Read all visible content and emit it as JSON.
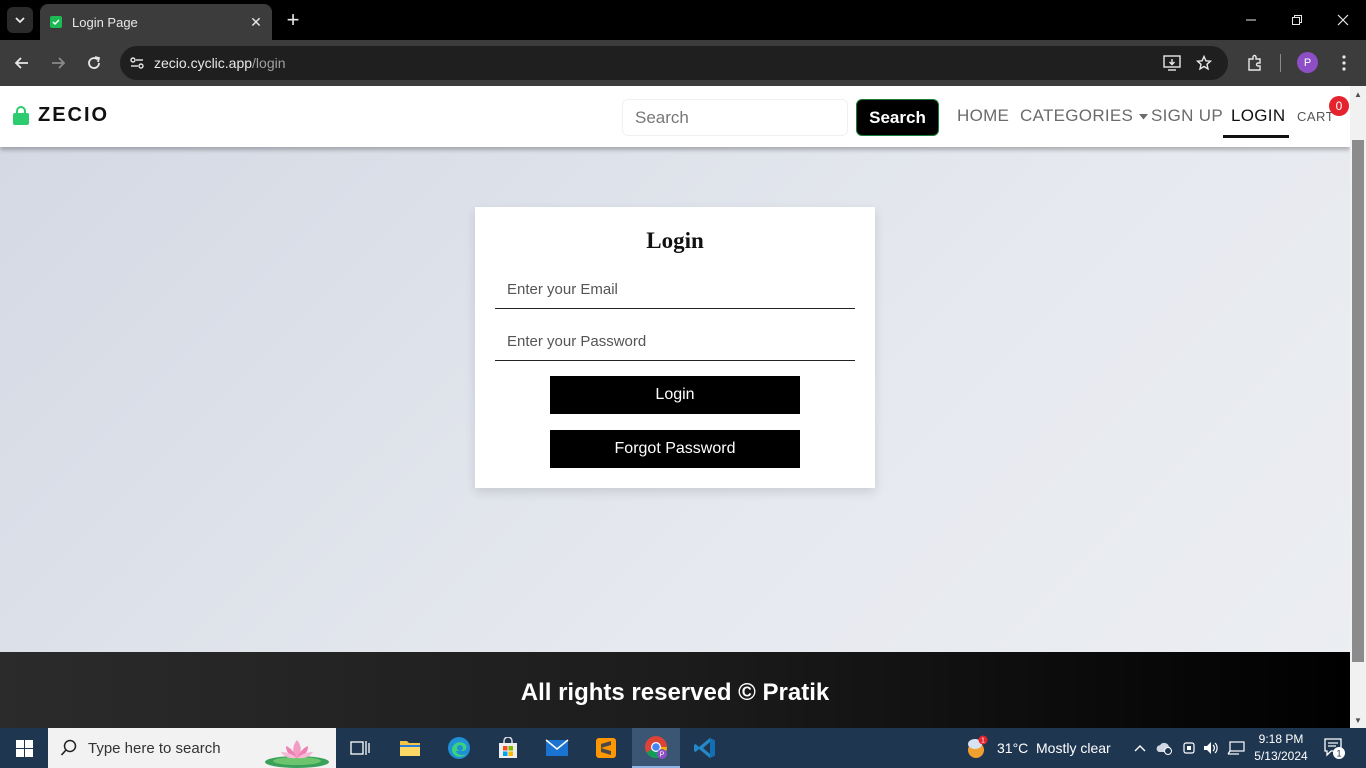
{
  "browser": {
    "tab_title": "Login Page",
    "url_domain": "zecio.cyclic.app",
    "url_path": "/login",
    "profile_initial": "P"
  },
  "site": {
    "brand": "ZECIO",
    "search_placeholder": "Search",
    "search_button": "Search",
    "nav": {
      "home": "HOME",
      "categories": "CATEGORIES",
      "signup": "SIGN UP",
      "login": "LOGIN",
      "cart": "CART",
      "cart_count": "0"
    }
  },
  "login_form": {
    "title": "Login",
    "email_placeholder": "Enter your Email",
    "password_placeholder": "Enter your Password",
    "login_button": "Login",
    "forgot_button": "Forgot Password"
  },
  "footer": {
    "text": "All rights reserved © Pratik"
  },
  "taskbar": {
    "search_placeholder": "Type here to search",
    "weather_temp": "31°C",
    "weather_desc": "Mostly clear",
    "weather_badge": "1",
    "time": "9:18 PM",
    "date": "5/13/2024",
    "notification_count": "1"
  },
  "colors": {
    "cart_badge": "#e5232e",
    "brand_bag": "#2ecc71",
    "taskbar": "#1f3650"
  }
}
